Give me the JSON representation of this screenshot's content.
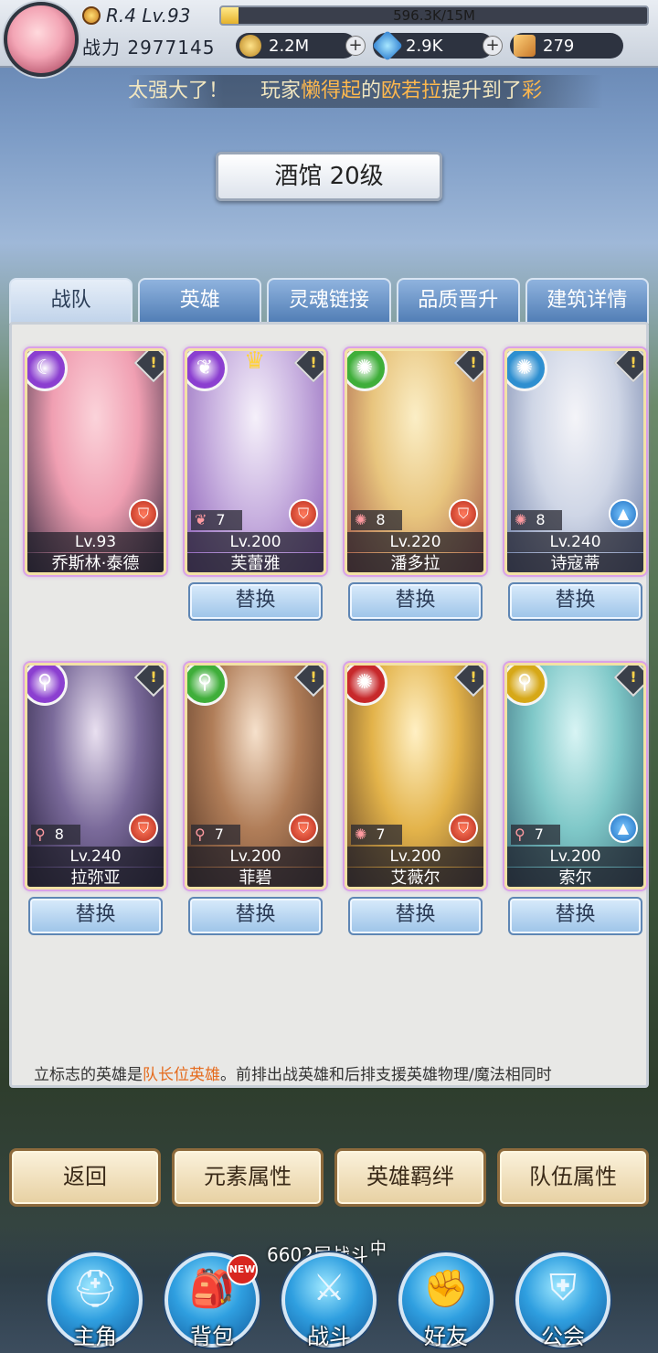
{
  "player": {
    "rank_level": "R.4 Lv.93",
    "exp_text": "596.3K/15M",
    "exp_fraction": 0.04,
    "power_label": "战力",
    "power_value": "2977145"
  },
  "currencies": [
    {
      "icon": "coin-icon",
      "value": "2.2M",
      "has_plus": true
    },
    {
      "icon": "gem-icon",
      "value": "2.9K",
      "has_plus": true
    },
    {
      "icon": "ticket-icon",
      "value": "279",
      "has_plus": false
    }
  ],
  "marquee": {
    "part1": "太强大了！",
    "part2": "玩家",
    "player_name": "懒得起",
    "part3": "的",
    "hero_name": "欧若拉",
    "part4": "提升到了",
    "tail": "彩"
  },
  "banner": {
    "title": "酒馆 20级"
  },
  "tabs": [
    {
      "label": "战队",
      "active": true
    },
    {
      "label": "英雄",
      "active": false
    },
    {
      "label": "灵魂链接",
      "active": false
    },
    {
      "label": "品质晋升",
      "active": false
    },
    {
      "label": "建筑详情",
      "active": false
    }
  ],
  "heroes_row1": [
    {
      "name": "乔斯林·泰德",
      "level": "Lv.93",
      "stars": "",
      "element_color": "#8b3fd0",
      "element_icon": "moon-icon",
      "class_icon": "warrior-icon",
      "crown": false,
      "art": [
        "#fbd3da",
        "#f09fb2",
        "#3c2e44"
      ]
    },
    {
      "name": "芙蕾雅",
      "level": "Lv.200",
      "stars": "7",
      "element_color": "#8b3fd0",
      "element_icon": "wings-icon",
      "class_icon": "warrior-icon",
      "crown": true,
      "art": [
        "#f5f0fa",
        "#c9b2e0",
        "#8c5fb8"
      ]
    },
    {
      "name": "潘多拉",
      "level": "Lv.220",
      "stars": "8",
      "element_color": "#3fae3a",
      "element_icon": "wind-icon",
      "class_icon": "warrior-icon",
      "crown": false,
      "art": [
        "#fbeec6",
        "#e8c57e",
        "#a35a4a"
      ]
    },
    {
      "name": "诗寇蒂",
      "level": "Lv.240",
      "stars": "8",
      "element_color": "#2e8fd0",
      "element_icon": "water-icon",
      "class_icon": "mage-icon",
      "crown": false,
      "art": [
        "#f4f4f8",
        "#cfd6e6",
        "#6f7fa8"
      ]
    }
  ],
  "heroes_row2": [
    {
      "name": "拉弥亚",
      "level": "Lv.240",
      "stars": "8",
      "element_color": "#8b3fd0",
      "element_icon": "search-icon",
      "class_icon": "warrior-icon",
      "crown": false,
      "art": [
        "#e9e0f0",
        "#7a6a9a",
        "#2a2240"
      ]
    },
    {
      "name": "菲碧",
      "level": "Lv.200",
      "stars": "7",
      "element_color": "#3fae3a",
      "element_icon": "search-icon",
      "class_icon": "warrior-icon",
      "crown": false,
      "art": [
        "#f6e1cc",
        "#b07d58",
        "#5a3a28"
      ]
    },
    {
      "name": "艾薇尔",
      "level": "Lv.200",
      "stars": "7",
      "element_color": "#c7282b",
      "element_icon": "wind-icon",
      "class_icon": "warrior-icon",
      "crown": false,
      "art": [
        "#fff0c4",
        "#e3b34a",
        "#6a4a2a"
      ]
    },
    {
      "name": "索尔",
      "level": "Lv.200",
      "stars": "7",
      "element_color": "#d6a818",
      "element_icon": "search-icon",
      "class_icon": "mage-icon",
      "crown": false,
      "art": [
        "#d8f4f4",
        "#7fc8c8",
        "#3a6a7a"
      ]
    }
  ],
  "replace_label": "替换",
  "hint": {
    "part1": "立标志的英雄是",
    "highlight": "队长位英雄",
    "part2": "。前排出战英雄和后排支援英雄物理/魔法相同时"
  },
  "actions": [
    {
      "label": "返回"
    },
    {
      "label": "元素属性"
    },
    {
      "label": "英雄羁绊"
    },
    {
      "label": "队伍属性"
    }
  ],
  "battle_status": {
    "text": "6602层战斗",
    "suffix": "中"
  },
  "nav": [
    {
      "label": "主角",
      "icon": "helmet-icon",
      "badge": ""
    },
    {
      "label": "背包",
      "icon": "backpack-icon",
      "badge": "NEW"
    },
    {
      "label": "战斗",
      "icon": "crossed-swords-icon",
      "badge": ""
    },
    {
      "label": "好友",
      "icon": "handshake-icon",
      "badge": ""
    },
    {
      "label": "公会",
      "icon": "guild-crest-icon",
      "badge": ""
    }
  ]
}
